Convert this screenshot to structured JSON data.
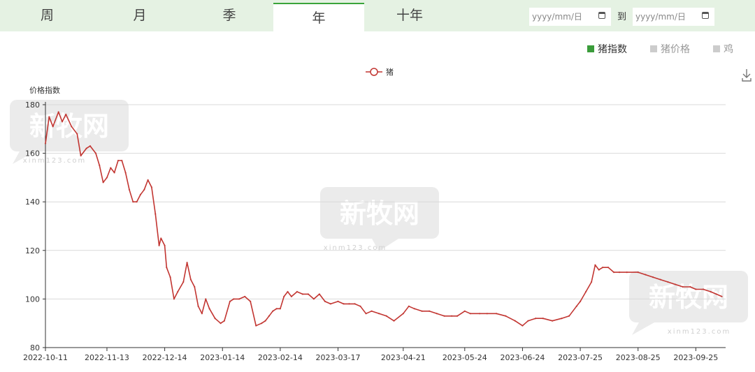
{
  "tabs": [
    {
      "label": "周",
      "active": false
    },
    {
      "label": "月",
      "active": false
    },
    {
      "label": "季",
      "active": false
    },
    {
      "label": "年",
      "active": true
    },
    {
      "label": "十年",
      "active": false
    }
  ],
  "date_range": {
    "start_placeholder": "yyyy/mm/日",
    "separator": "到",
    "end_placeholder": "yyyy/mm/日"
  },
  "series_toggles": [
    {
      "label": "猪指数",
      "active": true,
      "color": "#3a9c3a"
    },
    {
      "label": "猪价格",
      "active": false,
      "color": "#cccccc"
    },
    {
      "label": "鸡",
      "active": false,
      "color": "#cccccc"
    }
  ],
  "watermark": {
    "brand": "新牧网",
    "url": "xinm123.com"
  },
  "chart_data": {
    "type": "line",
    "ylabel": "价格指数",
    "ylim": [
      80,
      180
    ],
    "yticks": [
      80,
      100,
      120,
      140,
      160,
      180
    ],
    "grid": true,
    "xlim": [
      "2022-10-11",
      "2023-10-11"
    ],
    "xticks": [
      "2022-10-11",
      "2022-11-13",
      "2022-12-14",
      "2023-01-14",
      "2023-02-14",
      "2023-03-17",
      "2023-04-21",
      "2023-05-24",
      "2023-06-24",
      "2023-07-25",
      "2023-08-25",
      "2023-09-25"
    ],
    "legend": "top-center",
    "series": [
      {
        "name": "猪",
        "color": "#c23531",
        "points": [
          [
            "2022-10-11",
            164
          ],
          [
            "2022-10-13",
            175
          ],
          [
            "2022-10-15",
            171
          ],
          [
            "2022-10-18",
            177
          ],
          [
            "2022-10-20",
            173
          ],
          [
            "2022-10-22",
            176
          ],
          [
            "2022-10-25",
            171
          ],
          [
            "2022-10-28",
            168
          ],
          [
            "2022-10-30",
            159
          ],
          [
            "2022-11-02",
            162
          ],
          [
            "2022-11-04",
            163
          ],
          [
            "2022-11-07",
            160
          ],
          [
            "2022-11-09",
            155
          ],
          [
            "2022-11-11",
            148
          ],
          [
            "2022-11-13",
            150
          ],
          [
            "2022-11-15",
            154
          ],
          [
            "2022-11-17",
            152
          ],
          [
            "2022-11-19",
            157
          ],
          [
            "2022-11-21",
            157
          ],
          [
            "2022-11-23",
            152
          ],
          [
            "2022-11-25",
            145
          ],
          [
            "2022-11-27",
            140
          ],
          [
            "2022-11-29",
            140
          ],
          [
            "2022-12-01",
            143
          ],
          [
            "2022-12-03",
            145
          ],
          [
            "2022-12-05",
            149
          ],
          [
            "2022-12-07",
            146
          ],
          [
            "2022-12-09",
            135
          ],
          [
            "2022-12-11",
            122
          ],
          [
            "2022-12-12",
            125
          ],
          [
            "2022-12-14",
            122
          ],
          [
            "2022-12-15",
            113
          ],
          [
            "2022-12-17",
            109
          ],
          [
            "2022-12-19",
            100
          ],
          [
            "2022-12-21",
            103
          ],
          [
            "2022-12-24",
            107
          ],
          [
            "2022-12-26",
            115
          ],
          [
            "2022-12-28",
            108
          ],
          [
            "2022-12-30",
            105
          ],
          [
            "2023-01-01",
            97
          ],
          [
            "2023-01-03",
            94
          ],
          [
            "2023-01-05",
            100
          ],
          [
            "2023-01-07",
            96
          ],
          [
            "2023-01-10",
            92
          ],
          [
            "2023-01-13",
            90
          ],
          [
            "2023-01-15",
            91
          ],
          [
            "2023-01-18",
            99
          ],
          [
            "2023-01-20",
            100
          ],
          [
            "2023-01-23",
            100
          ],
          [
            "2023-01-26",
            101
          ],
          [
            "2023-01-29",
            99
          ],
          [
            "2023-02-01",
            89
          ],
          [
            "2023-02-04",
            90
          ],
          [
            "2023-02-06",
            91
          ],
          [
            "2023-02-08",
            93
          ],
          [
            "2023-02-10",
            95
          ],
          [
            "2023-02-12",
            96
          ],
          [
            "2023-02-14",
            96
          ],
          [
            "2023-02-16",
            101
          ],
          [
            "2023-02-18",
            103
          ],
          [
            "2023-02-20",
            101
          ],
          [
            "2023-02-23",
            103
          ],
          [
            "2023-02-26",
            102
          ],
          [
            "2023-03-01",
            102
          ],
          [
            "2023-03-04",
            100
          ],
          [
            "2023-03-07",
            102
          ],
          [
            "2023-03-10",
            99
          ],
          [
            "2023-03-13",
            98
          ],
          [
            "2023-03-17",
            99
          ],
          [
            "2023-03-20",
            98
          ],
          [
            "2023-03-23",
            98
          ],
          [
            "2023-03-26",
            98
          ],
          [
            "2023-03-29",
            97
          ],
          [
            "2023-04-01",
            94
          ],
          [
            "2023-04-04",
            95
          ],
          [
            "2023-04-08",
            94
          ],
          [
            "2023-04-12",
            93
          ],
          [
            "2023-04-16",
            91
          ],
          [
            "2023-04-21",
            94
          ],
          [
            "2023-04-24",
            97
          ],
          [
            "2023-04-27",
            96
          ],
          [
            "2023-05-01",
            95
          ],
          [
            "2023-05-05",
            95
          ],
          [
            "2023-05-09",
            94
          ],
          [
            "2023-05-13",
            93
          ],
          [
            "2023-05-17",
            93
          ],
          [
            "2023-05-20",
            93
          ],
          [
            "2023-05-24",
            95
          ],
          [
            "2023-05-27",
            94
          ],
          [
            "2023-06-01",
            94
          ],
          [
            "2023-06-05",
            94
          ],
          [
            "2023-06-10",
            94
          ],
          [
            "2023-06-15",
            93
          ],
          [
            "2023-06-20",
            91
          ],
          [
            "2023-06-24",
            89
          ],
          [
            "2023-06-27",
            91
          ],
          [
            "2023-07-01",
            92
          ],
          [
            "2023-07-05",
            92
          ],
          [
            "2023-07-10",
            91
          ],
          [
            "2023-07-15",
            92
          ],
          [
            "2023-07-19",
            93
          ],
          [
            "2023-07-23",
            97
          ],
          [
            "2023-07-25",
            99
          ],
          [
            "2023-07-28",
            103
          ],
          [
            "2023-07-31",
            107
          ],
          [
            "2023-08-02",
            114
          ],
          [
            "2023-08-04",
            112
          ],
          [
            "2023-08-06",
            113
          ],
          [
            "2023-08-09",
            113
          ],
          [
            "2023-08-12",
            111
          ],
          [
            "2023-08-15",
            111
          ],
          [
            "2023-08-19",
            111
          ],
          [
            "2023-08-25",
            111
          ],
          [
            "2023-08-29",
            110
          ],
          [
            "2023-09-02",
            109
          ],
          [
            "2023-09-06",
            108
          ],
          [
            "2023-09-10",
            107
          ],
          [
            "2023-09-14",
            106
          ],
          [
            "2023-09-18",
            105
          ],
          [
            "2023-09-22",
            105
          ],
          [
            "2023-09-25",
            104
          ],
          [
            "2023-09-29",
            104
          ],
          [
            "2023-10-03",
            103
          ],
          [
            "2023-10-06",
            102
          ],
          [
            "2023-10-09",
            101
          ]
        ]
      }
    ]
  }
}
